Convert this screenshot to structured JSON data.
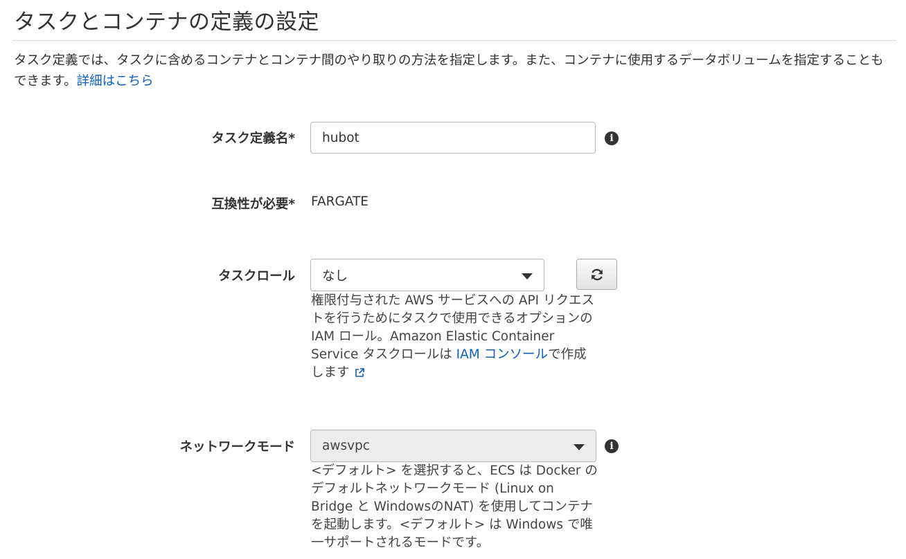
{
  "page": {
    "title": "タスクとコンテナの定義の設定",
    "intro_text": "タスク定義では、タスクに含めるコンテナとコンテナ間のやり取りの方法を指定します。また、コンテナに使用するデータボリュームを指定することもできます。",
    "intro_link": "詳細はこちら"
  },
  "form": {
    "task_name": {
      "label": "タスク定義名*",
      "value": "hubot"
    },
    "compatibility": {
      "label": "互換性が必要*",
      "value": "FARGATE"
    },
    "task_role": {
      "label": "タスクロール",
      "selected": "なし",
      "help_text": "権限付与された AWS サービスへの API リクエストを行うためにタスクで使用できるオプションの IAM ロール。Amazon Elastic Container Service タスクロールは ",
      "help_link": "IAM コンソール",
      "help_suffix": "で作成します"
    },
    "network_mode": {
      "label": "ネットワークモード",
      "selected": "awsvpc",
      "help_text": "<デフォルト> を選択すると、ECS は Docker のデフォルトネットワークモード (Linux on Bridge と WindowsのNAT) を使用してコンテナを起動します。<デフォルト> は Windows で唯一サポートされるモードです。"
    }
  },
  "icons": {
    "info": "info-circle-icon",
    "refresh": "refresh-icon",
    "external": "external-link-icon",
    "dropdown": "chevron-down-icon"
  },
  "colors": {
    "link": "#0f5fb8",
    "text": "#333333",
    "disabled_select_bg": "#ececec"
  }
}
